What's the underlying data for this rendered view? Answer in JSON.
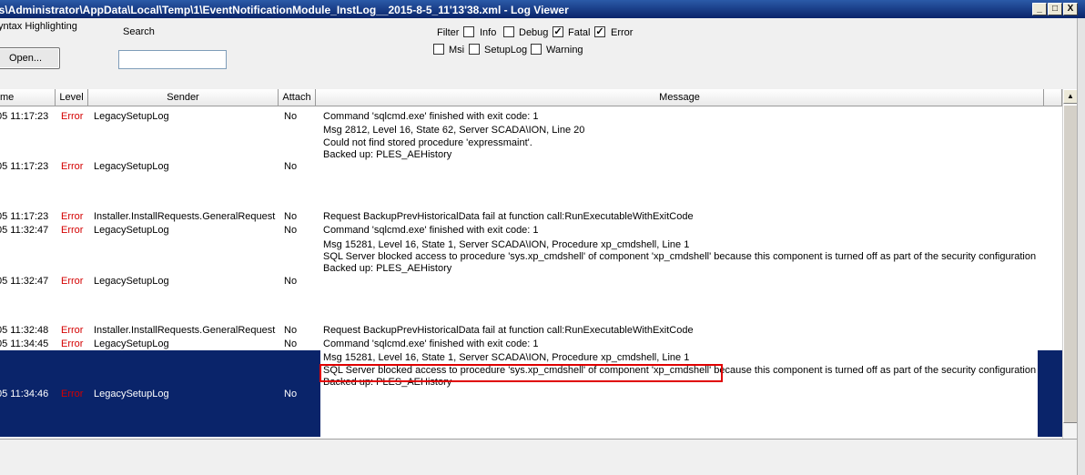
{
  "window": {
    "title": "rs\\Administrator\\AppData\\Local\\Temp\\1\\EventNotificationModule_InstLog__2015-8-5_11'13'38.xml - Log Viewer",
    "min": "_",
    "max": "□",
    "close": "X"
  },
  "toolbar": {
    "syntax_label": "yntax Highlighting",
    "search_label": "Search",
    "search_value": "",
    "open_label": "Open...",
    "filter_label": "Filter"
  },
  "filters": [
    {
      "label": "Info",
      "checked": false
    },
    {
      "label": "Debug",
      "checked": false
    },
    {
      "label": "Fatal",
      "checked": true
    },
    {
      "label": "Error",
      "checked": true
    },
    {
      "label": "Msi",
      "checked": false
    },
    {
      "label": "SetupLog",
      "checked": false
    },
    {
      "label": "Warning",
      "checked": false
    }
  ],
  "check_mark": "✓",
  "columns": [
    "me",
    "Level",
    "Sender",
    "Attach",
    "Message"
  ],
  "rows": [
    {
      "time": "05 11:17:23",
      "level": "Error",
      "sender": "LegacySetupLog",
      "attach": "No",
      "message": [
        "Command 'sqlcmd.exe' finished with exit code: 1",
        "Msg 2812, Level 16, State 62, Server SCADA\\ION, Line 20",
        "Could not find stored procedure 'expressmaint'.",
        "Backed up: PLES_AEHistory"
      ]
    },
    {
      "time": "05 11:17:23",
      "level": "Error",
      "sender": "LegacySetupLog",
      "attach": "No",
      "message": []
    },
    {
      "time": "05 11:17:23",
      "level": "Error",
      "sender": "Installer.InstallRequests.GeneralRequest",
      "attach": "No",
      "message": [
        "Request BackupPrevHistoricalData fail at function call:RunExecutableWithExitCode"
      ]
    },
    {
      "time": "05 11:32:47",
      "level": "Error",
      "sender": "LegacySetupLog",
      "attach": "No",
      "message": [
        "Command 'sqlcmd.exe' finished with exit code: 1",
        "Msg 15281, Level 16, State 1, Server SCADA\\ION, Procedure xp_cmdshell, Line 1",
        "SQL Server blocked access to procedure 'sys.xp_cmdshell' of component 'xp_cmdshell' because this component is turned off as part of the security configuration",
        "Backed up: PLES_AEHistory"
      ]
    },
    {
      "time": "05 11:32:47",
      "level": "Error",
      "sender": "LegacySetupLog",
      "attach": "No",
      "message": []
    },
    {
      "time": "05 11:32:48",
      "level": "Error",
      "sender": "Installer.InstallRequests.GeneralRequest",
      "attach": "No",
      "message": [
        "Request BackupPrevHistoricalData fail at function call:RunExecutableWithExitCode"
      ]
    },
    {
      "time": "05 11:34:45",
      "level": "Error",
      "sender": "LegacySetupLog",
      "attach": "No",
      "message": [
        "Command 'sqlcmd.exe' finished with exit code: 1"
      ]
    },
    {
      "time": "05 11:34:46",
      "level": "Error",
      "sender": "LegacySetupLog",
      "attach": "No",
      "message": [
        "Msg 15281, Level 16, State 1, Server SCADA\\ION, Procedure xp_cmdshell, Line 1",
        "SQL Server blocked access to procedure 'sys.xp_cmdshell' of component 'xp_cmdshell' because this component is turned off as part of the security configuration",
        "Backed up: PLES_AEHistory"
      ]
    }
  ],
  "scroll": {
    "up": "▲"
  }
}
